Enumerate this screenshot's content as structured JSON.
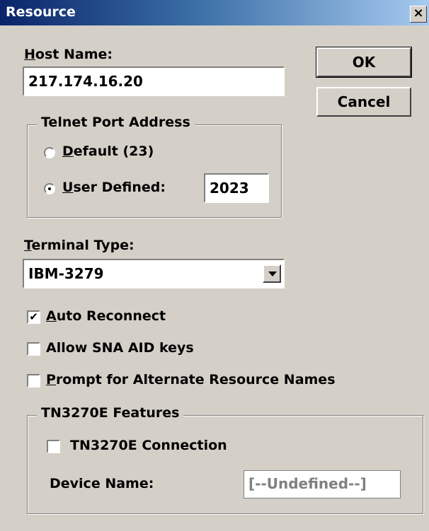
{
  "window": {
    "title": "Resource",
    "close_glyph": "×"
  },
  "host": {
    "label": "Host Name:",
    "value": "217.174.16.20"
  },
  "buttons": {
    "ok": "OK",
    "cancel": "Cancel"
  },
  "telnet": {
    "legend": "Telnet Port Address",
    "default_label": "Default (23)",
    "user_label": "User Defined:",
    "selected": "user",
    "port_value": "2023"
  },
  "terminal": {
    "label": "Terminal Type:",
    "value": "IBM-3279"
  },
  "options": {
    "auto_reconnect": {
      "label": "Auto Reconnect",
      "checked": true
    },
    "allow_sna": {
      "label": "Allow SNA AID keys",
      "checked": false
    },
    "prompt_alt": {
      "label": "Prompt for Alternate Resource Names",
      "checked": false
    }
  },
  "tn3270e": {
    "legend": "TN3270E Features",
    "connection_label": "TN3270E Connection",
    "connection_checked": false,
    "device_label": "Device Name:",
    "device_value": "[--Undefined--]"
  },
  "colors": {
    "face": "#d4d0c8",
    "title_start": "#0a246a",
    "title_end": "#a6caf0",
    "disabled_text": "#808080"
  }
}
